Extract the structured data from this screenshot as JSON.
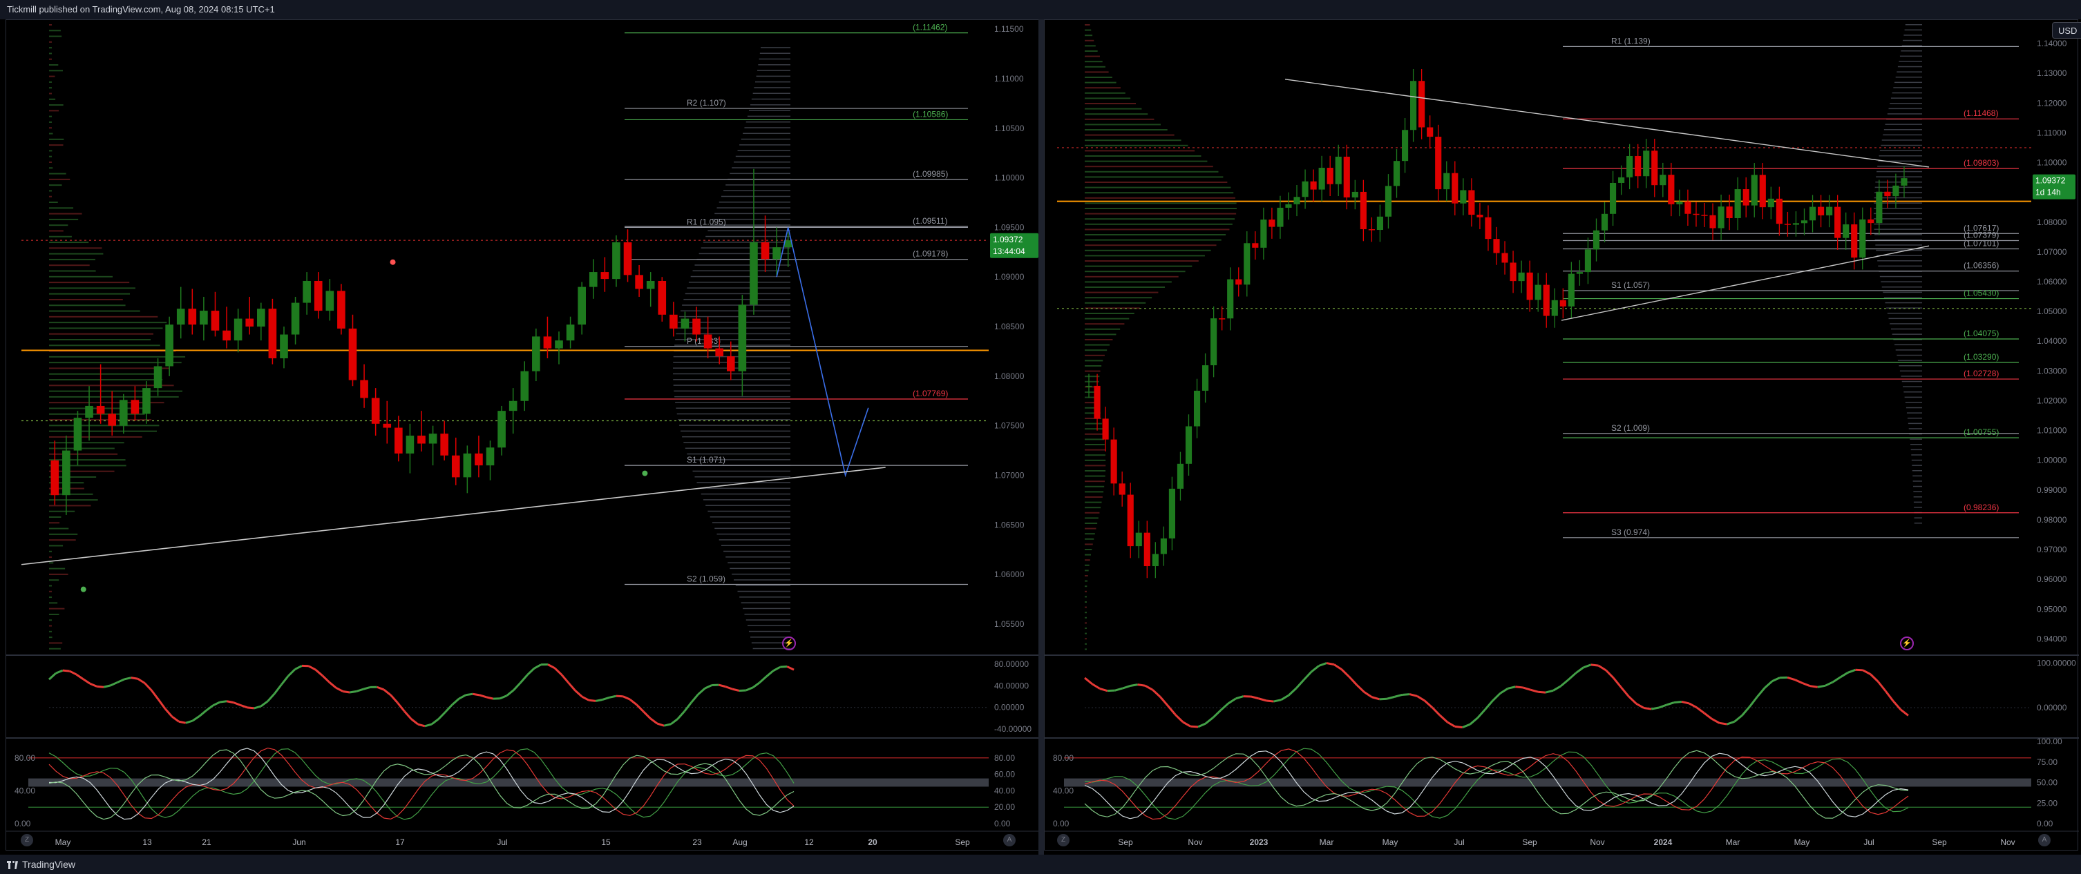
{
  "header": {
    "publisher": "Tickmill published on TradingView.com, Aug 08, 2024 08:15 UTC+1"
  },
  "footer": {
    "brand": "TradingView"
  },
  "controls": {
    "currency": "USD",
    "zoom_button": "Z",
    "auto_button": "A",
    "alert_icon": "⚡"
  },
  "colors": {
    "up": "#089981",
    "candle_up": "#1e7a1e",
    "candle_down": "#e00000",
    "orange": "#ff9800",
    "red_line": "#f23645",
    "green_line": "#4caf50",
    "grey_line": "#9598a1",
    "blue": "#3a6ee8",
    "violet": "#9c27b0"
  },
  "chart_data": [
    {
      "type": "candlestick",
      "timeframe": "daily",
      "x_ticks": [
        "May",
        "13",
        "21",
        "Jun",
        "17",
        "Jul",
        "15",
        "23",
        "Aug",
        "12",
        "20",
        "Sep"
      ],
      "y_ticks": [
        "1.11500",
        "1.11000",
        "1.10500",
        "1.10000",
        "1.09500",
        "1.09000",
        "1.08500",
        "1.08000",
        "1.07500",
        "1.07000",
        "1.06500",
        "1.06000",
        "1.05500"
      ],
      "ylim": [
        1.052,
        1.1155
      ],
      "last_price": "1.09372",
      "countdown": "13:44:04",
      "levels": [
        {
          "label": "(1.11462)",
          "value": 1.11462,
          "color": "green"
        },
        {
          "label": "R2 (1.107)",
          "value": 1.107,
          "color": "grey"
        },
        {
          "label": "(1.10586)",
          "value": 1.10586,
          "color": "green"
        },
        {
          "label": "(1.09985)",
          "value": 1.09985,
          "color": "grey"
        },
        {
          "label": "R1 (1.095)",
          "value": 1.095,
          "color": "grey"
        },
        {
          "label": "(1.09511)",
          "value": 1.09511,
          "color": "grey"
        },
        {
          "label": "(1.09178)",
          "value": 1.09178,
          "color": "grey"
        },
        {
          "label": "P (1.083)",
          "value": 1.083,
          "color": "grey"
        },
        {
          "label": "(1.07769)",
          "value": 1.07769,
          "color": "red"
        },
        {
          "label": "S1 (1.071)",
          "value": 1.071,
          "color": "grey"
        },
        {
          "label": "S2 (1.059)",
          "value": 1.059,
          "color": "grey"
        }
      ],
      "candles": [
        {
          "o": 1.0715,
          "h": 1.0735,
          "l": 1.067,
          "c": 1.068
        },
        {
          "o": 1.068,
          "h": 1.074,
          "l": 1.066,
          "c": 1.0725
        },
        {
          "o": 1.0725,
          "h": 1.0765,
          "l": 1.071,
          "c": 1.0758
        },
        {
          "o": 1.0758,
          "h": 1.079,
          "l": 1.0735,
          "c": 1.077
        },
        {
          "o": 1.077,
          "h": 1.0812,
          "l": 1.0752,
          "c": 1.0762
        },
        {
          "o": 1.0762,
          "h": 1.0785,
          "l": 1.074,
          "c": 1.075
        },
        {
          "o": 1.075,
          "h": 1.0782,
          "l": 1.0742,
          "c": 1.0776
        },
        {
          "o": 1.0776,
          "h": 1.079,
          "l": 1.0755,
          "c": 1.0762
        },
        {
          "o": 1.0762,
          "h": 1.0795,
          "l": 1.0752,
          "c": 1.0788
        },
        {
          "o": 1.0788,
          "h": 1.0818,
          "l": 1.078,
          "c": 1.081
        },
        {
          "o": 1.081,
          "h": 1.086,
          "l": 1.08,
          "c": 1.0852
        },
        {
          "o": 1.0852,
          "h": 1.089,
          "l": 1.0838,
          "c": 1.0868
        },
        {
          "o": 1.0868,
          "h": 1.0888,
          "l": 1.0842,
          "c": 1.0852
        },
        {
          "o": 1.0852,
          "h": 1.088,
          "l": 1.0836,
          "c": 1.0866
        },
        {
          "o": 1.0866,
          "h": 1.0885,
          "l": 1.084,
          "c": 1.0846
        },
        {
          "o": 1.0846,
          "h": 1.087,
          "l": 1.0828,
          "c": 1.0836
        },
        {
          "o": 1.0836,
          "h": 1.0868,
          "l": 1.0824,
          "c": 1.0858
        },
        {
          "o": 1.0858,
          "h": 1.088,
          "l": 1.0842,
          "c": 1.085
        },
        {
          "o": 1.085,
          "h": 1.0874,
          "l": 1.0836,
          "c": 1.0868
        },
        {
          "o": 1.0868,
          "h": 1.0878,
          "l": 1.0812,
          "c": 1.0818
        },
        {
          "o": 1.0818,
          "h": 1.085,
          "l": 1.0808,
          "c": 1.0842
        },
        {
          "o": 1.0842,
          "h": 1.088,
          "l": 1.0832,
          "c": 1.0874
        },
        {
          "o": 1.0874,
          "h": 1.0905,
          "l": 1.0862,
          "c": 1.0896
        },
        {
          "o": 1.0896,
          "h": 1.0905,
          "l": 1.0858,
          "c": 1.0866
        },
        {
          "o": 1.0866,
          "h": 1.0898,
          "l": 1.0856,
          "c": 1.0886
        },
        {
          "o": 1.0886,
          "h": 1.0893,
          "l": 1.0842,
          "c": 1.0848
        },
        {
          "o": 1.0848,
          "h": 1.0862,
          "l": 1.079,
          "c": 1.0796
        },
        {
          "o": 1.0796,
          "h": 1.0812,
          "l": 1.0768,
          "c": 1.0778
        },
        {
          "o": 1.0778,
          "h": 1.0788,
          "l": 1.074,
          "c": 1.0752
        },
        {
          "o": 1.0752,
          "h": 1.0775,
          "l": 1.0732,
          "c": 1.0748
        },
        {
          "o": 1.0748,
          "h": 1.076,
          "l": 1.0714,
          "c": 1.0722
        },
        {
          "o": 1.0722,
          "h": 1.0752,
          "l": 1.0702,
          "c": 1.074
        },
        {
          "o": 1.074,
          "h": 1.0765,
          "l": 1.0724,
          "c": 1.0732
        },
        {
          "o": 1.0732,
          "h": 1.075,
          "l": 1.071,
          "c": 1.0742
        },
        {
          "o": 1.0742,
          "h": 1.0755,
          "l": 1.0715,
          "c": 1.072
        },
        {
          "o": 1.072,
          "h": 1.0738,
          "l": 1.069,
          "c": 1.0698
        },
        {
          "o": 1.0698,
          "h": 1.073,
          "l": 1.0682,
          "c": 1.0722
        },
        {
          "o": 1.0722,
          "h": 1.074,
          "l": 1.0698,
          "c": 1.071
        },
        {
          "o": 1.071,
          "h": 1.0735,
          "l": 1.0695,
          "c": 1.0728
        },
        {
          "o": 1.0728,
          "h": 1.077,
          "l": 1.072,
          "c": 1.0765
        },
        {
          "o": 1.0765,
          "h": 1.0788,
          "l": 1.0742,
          "c": 1.0775
        },
        {
          "o": 1.0775,
          "h": 1.0815,
          "l": 1.0765,
          "c": 1.0805
        },
        {
          "o": 1.0805,
          "h": 1.0848,
          "l": 1.0795,
          "c": 1.084
        },
        {
          "o": 1.084,
          "h": 1.086,
          "l": 1.0818,
          "c": 1.0828
        },
        {
          "o": 1.0828,
          "h": 1.0845,
          "l": 1.0812,
          "c": 1.0836
        },
        {
          "o": 1.0836,
          "h": 1.086,
          "l": 1.0828,
          "c": 1.0852
        },
        {
          "o": 1.0852,
          "h": 1.0895,
          "l": 1.0842,
          "c": 1.089
        },
        {
          "o": 1.089,
          "h": 1.0918,
          "l": 1.0878,
          "c": 1.0905
        },
        {
          "o": 1.0905,
          "h": 1.092,
          "l": 1.0885,
          "c": 1.0898
        },
        {
          "o": 1.0898,
          "h": 1.0942,
          "l": 1.089,
          "c": 1.0935
        },
        {
          "o": 1.0935,
          "h": 1.0948,
          "l": 1.0895,
          "c": 1.0902
        },
        {
          "o": 1.0902,
          "h": 1.0912,
          "l": 1.088,
          "c": 1.0888
        },
        {
          "o": 1.0888,
          "h": 1.0905,
          "l": 1.087,
          "c": 1.0896
        },
        {
          "o": 1.0896,
          "h": 1.09,
          "l": 1.0855,
          "c": 1.0862
        },
        {
          "o": 1.0862,
          "h": 1.0875,
          "l": 1.084,
          "c": 1.0848
        },
        {
          "o": 1.0848,
          "h": 1.0865,
          "l": 1.0835,
          "c": 1.0858
        },
        {
          "o": 1.0858,
          "h": 1.087,
          "l": 1.0835,
          "c": 1.0842
        },
        {
          "o": 1.0842,
          "h": 1.086,
          "l": 1.0818,
          "c": 1.0828
        },
        {
          "o": 1.0828,
          "h": 1.084,
          "l": 1.0812,
          "c": 1.082
        },
        {
          "o": 1.082,
          "h": 1.0835,
          "l": 1.0796,
          "c": 1.0805
        },
        {
          "o": 1.0805,
          "h": 1.0882,
          "l": 1.078,
          "c": 1.0872
        },
        {
          "o": 1.0872,
          "h": 1.1009,
          "l": 1.0862,
          "c": 1.0935
        },
        {
          "o": 1.0935,
          "h": 1.0962,
          "l": 1.0905,
          "c": 1.0918
        },
        {
          "o": 1.0918,
          "h": 1.095,
          "l": 1.0902,
          "c": 1.093
        },
        {
          "o": 1.093,
          "h": 1.0945,
          "l": 1.091,
          "c": 1.0937
        }
      ],
      "blue_path": [
        [
          63,
          1.09
        ],
        [
          64,
          1.095
        ],
        [
          69,
          1.07
        ],
        [
          71,
          1.0768
        ]
      ],
      "trendline": [
        [
          0,
          1.061
        ],
        [
          73,
          1.0708
        ]
      ],
      "dots": [
        {
          "i": 3,
          "v": 1.0585,
          "color": "green"
        },
        {
          "i": 30,
          "v": 1.0915,
          "color": "red"
        },
        {
          "i": 52,
          "v": 1.0702,
          "color": "green"
        }
      ],
      "oscillator1": {
        "ticks": [
          "80.00000",
          "40.00000",
          "0.00000",
          "-40.00000"
        ],
        "ylim": [
          -50,
          90
        ]
      },
      "oscillator2": {
        "ticks": [
          "80.00",
          "60.00",
          "40.00",
          "20.00",
          "0.00"
        ],
        "left_ticks": [
          "80.00",
          "40.00",
          "0.00"
        ],
        "ylim": [
          -5,
          100
        ]
      }
    },
    {
      "type": "candlestick",
      "timeframe": "weekly",
      "x_ticks": [
        "Sep",
        "Nov",
        "2023",
        "Mar",
        "May",
        "Jul",
        "Sep",
        "Nov",
        "2024",
        "Mar",
        "May",
        "Jul",
        "Sep",
        "Nov"
      ],
      "y_ticks": [
        "1.14000",
        "1.13000",
        "1.12000",
        "1.11000",
        "1.10000",
        "1.09000",
        "1.08000",
        "1.07000",
        "1.06000",
        "1.05000",
        "1.04000",
        "1.03000",
        "1.02000",
        "1.01000",
        "1.00000",
        "0.99000",
        "0.98000",
        "0.97000",
        "0.96000",
        "0.95000",
        "0.94000"
      ],
      "ylim": [
        0.935,
        1.1465
      ],
      "last_price": "1.09372",
      "countdown": "1d 14h",
      "levels": [
        {
          "label": "R1 (1.139)",
          "value": 1.139,
          "color": "grey"
        },
        {
          "label": "(1.11468)",
          "value": 1.11468,
          "color": "red"
        },
        {
          "label": "(1.09803)",
          "value": 1.09803,
          "color": "red"
        },
        {
          "label": "(1.07617)",
          "value": 1.07617,
          "color": "grey"
        },
        {
          "label": "(1.07379)",
          "value": 1.07379,
          "color": "grey"
        },
        {
          "label": "(1.07101)",
          "value": 1.07101,
          "color": "grey"
        },
        {
          "label": "(1.06356)",
          "value": 1.06356,
          "color": "grey"
        },
        {
          "label": "S1 (1.057)",
          "value": 1.057,
          "color": "grey"
        },
        {
          "label": "(1.05430)",
          "value": 1.0543,
          "color": "green"
        },
        {
          "label": "(1.04075)",
          "value": 1.04075,
          "color": "green"
        },
        {
          "label": "(1.03290)",
          "value": 1.0329,
          "color": "green"
        },
        {
          "label": "(1.02728)",
          "value": 1.02728,
          "color": "red"
        },
        {
          "label": "S2 (1.009)",
          "value": 1.009,
          "color": "grey"
        },
        {
          "label": "(1.00755)",
          "value": 1.00755,
          "color": "green"
        },
        {
          "label": "(0.98236)",
          "value": 0.98236,
          "color": "red"
        },
        {
          "label": "S3 (0.974)",
          "value": 0.974,
          "color": "grey"
        }
      ],
      "oscillator1": {
        "ticks": [
          "100.00000",
          "0.00000"
        ],
        "ylim": [
          -60,
          110
        ]
      },
      "oscillator2": {
        "ticks": [
          "100.00",
          "75.00",
          "50.00",
          "25.00",
          "0.00"
        ],
        "left_ticks": [
          "80.00",
          "40.00",
          "0.00"
        ],
        "ylim": [
          -5,
          100
        ]
      }
    }
  ]
}
